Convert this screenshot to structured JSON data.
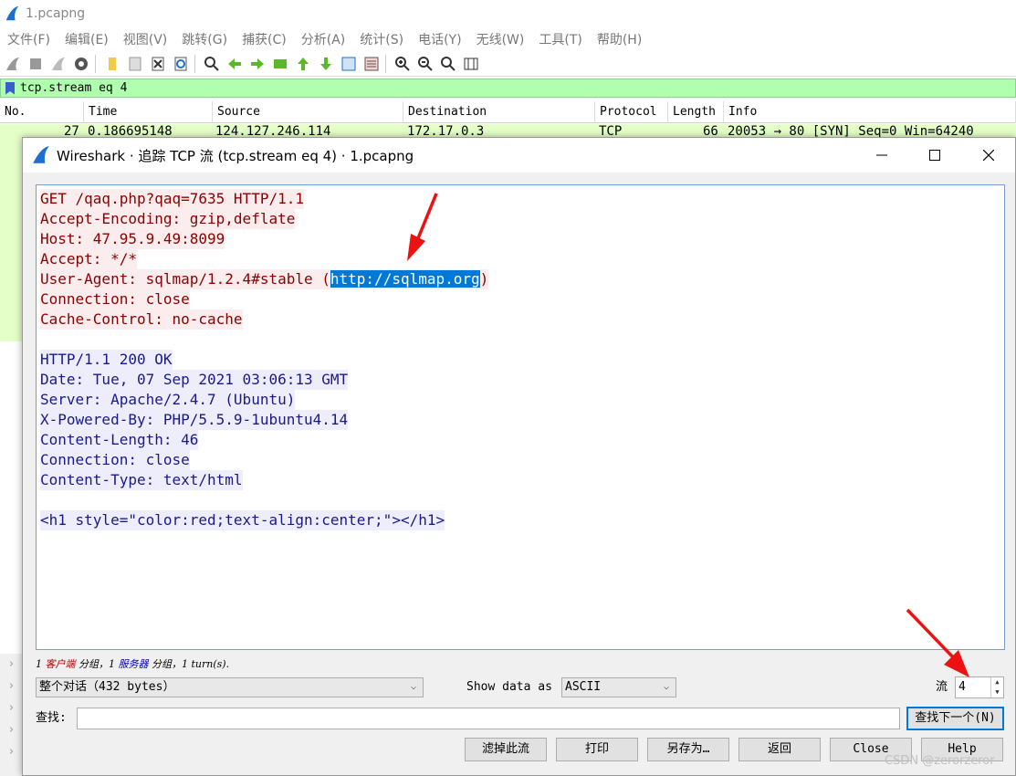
{
  "main_window": {
    "title": "1.pcapng",
    "menu": [
      "文件(F)",
      "编辑(E)",
      "视图(V)",
      "跳转(G)",
      "捕获(C)",
      "分析(A)",
      "统计(S)",
      "电话(Y)",
      "无线(W)",
      "工具(T)",
      "帮助(H)"
    ],
    "filter_text": "tcp.stream eq 4",
    "columns": [
      "No.",
      "Time",
      "Source",
      "Destination",
      "Protocol",
      "Length",
      "Info"
    ],
    "packet_row": {
      "no": "27",
      "time": "0.186695148",
      "source": "124.127.246.114",
      "destination": "172.17.0.3",
      "protocol": "TCP",
      "length": "66",
      "info": "20053 → 80 [SYN] Seq=0 Win=64240"
    }
  },
  "dialog": {
    "title": "Wireshark · 追踪 TCP 流 (tcp.stream eq 4) · 1.pcapng",
    "request_lines": [
      "GET /qaq.php?qaq=7635 HTTP/1.1",
      "Accept-Encoding: gzip,deflate",
      "Host: 47.95.9.49:8099",
      "Accept: */*"
    ],
    "user_agent_prefix": "User-Agent: sqlmap/1.2.4#stable (",
    "user_agent_selected": "http://sqlmap.org",
    "user_agent_suffix": ")",
    "request_lines_tail": [
      "Connection: close",
      "Cache-Control: no-cache"
    ],
    "response_lines": [
      "HTTP/1.1 200 OK",
      "Date: Tue, 07 Sep 2021 03:06:13 GMT",
      "Server: Apache/2.4.7 (Ubuntu)",
      "X-Powered-By: PHP/5.5.9-1ubuntu4.14",
      "Content-Length: 46",
      "Connection: close",
      "Content-Type: text/html"
    ],
    "response_body": "<h1 style=\"color:red;text-align:center;\"></h1>",
    "status": {
      "p1": "1 ",
      "client": "客户端",
      "p2": " 分组，1 ",
      "server": "服务器",
      "p3": " 分组，1 turn(s)."
    },
    "conversation_select": "整个对话（432 bytes）",
    "show_data_as_label": "Show data as",
    "show_data_as_value": "ASCII",
    "stream_label": "流",
    "stream_number": "4",
    "find_label": "查找:",
    "find_value": "",
    "find_next_button": "查找下一个(N)",
    "buttons": {
      "filter_out": "滤掉此流",
      "print": "打印",
      "save_as": "另存为…",
      "back": "返回",
      "close": "Close",
      "help": "Help"
    }
  },
  "watermark": "CSDN @zerorzeror",
  "colors": {
    "client_text": "#8b0000",
    "client_bg": "#fbeded",
    "server_text": "#1a1a8b",
    "server_bg": "#ededfb",
    "filter_bg": "#afffaf",
    "selection": "#0078d7",
    "arrow": "#ee1111"
  }
}
